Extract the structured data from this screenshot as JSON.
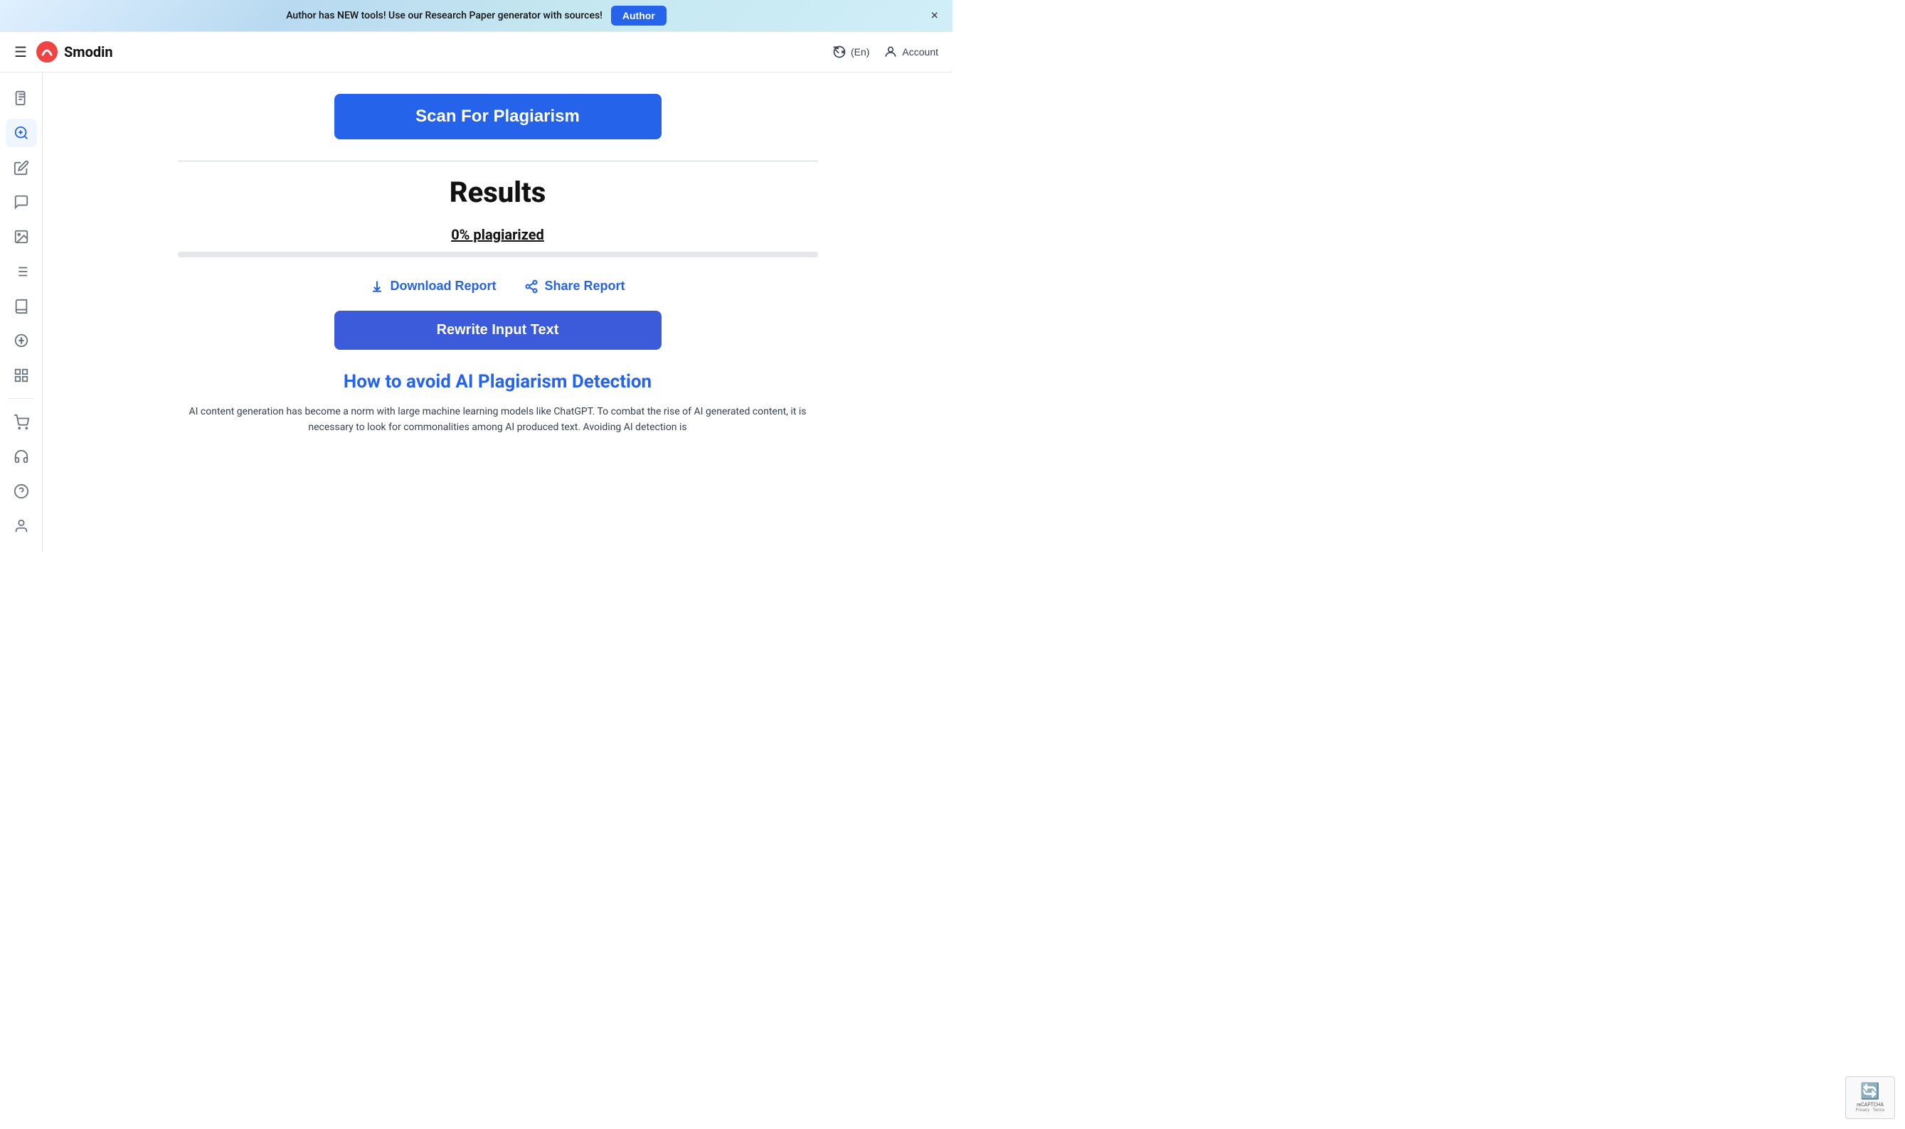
{
  "announcement": {
    "text": "Author has NEW tools! Use our Research Paper generator with sources!",
    "button_label": "Author",
    "close_label": "×"
  },
  "header": {
    "logo_text": "Smodin",
    "language_label": "(En)",
    "account_label": "Account"
  },
  "sidebar": {
    "items": [
      {
        "name": "document-icon",
        "icon": "📄",
        "active": false
      },
      {
        "name": "plagiarism-icon",
        "icon": "🔍",
        "active": true
      },
      {
        "name": "edit-icon",
        "icon": "✏️",
        "active": false
      },
      {
        "name": "chat-icon",
        "icon": "💬",
        "active": false
      },
      {
        "name": "image-icon",
        "icon": "🖼️",
        "active": false
      },
      {
        "name": "list-icon",
        "icon": "≡",
        "active": false
      },
      {
        "name": "library-icon",
        "icon": "📚",
        "active": false
      },
      {
        "name": "text-icon",
        "icon": "A",
        "active": false
      },
      {
        "name": "apps-icon",
        "icon": "⊞",
        "active": false
      },
      {
        "name": "cart-icon",
        "icon": "🛒",
        "active": false
      },
      {
        "name": "support-icon",
        "icon": "🎧",
        "active": false
      },
      {
        "name": "help-icon",
        "icon": "?",
        "active": false
      },
      {
        "name": "user-icon",
        "icon": "👤",
        "active": false
      }
    ]
  },
  "main": {
    "scan_button_label": "Scan For Plagiarism",
    "results_title": "Results",
    "plagiarism_score": "0% plagiarized",
    "progress_value": 0,
    "download_report_label": "Download Report",
    "share_report_label": "Share Report",
    "rewrite_button_label": "Rewrite Input Text",
    "avoid_title": "How to avoid AI Plagiarism Detection",
    "avoid_text": "AI content generation has become a norm with large machine learning models like ChatGPT. To combat the rise of AI generated content, it is necessary to look for commonalities among AI produced text. Avoiding AI detection is"
  },
  "recaptcha": {
    "logo": "🔄",
    "line1": "reCAPTCHA",
    "line2": "Privacy - Terms"
  }
}
